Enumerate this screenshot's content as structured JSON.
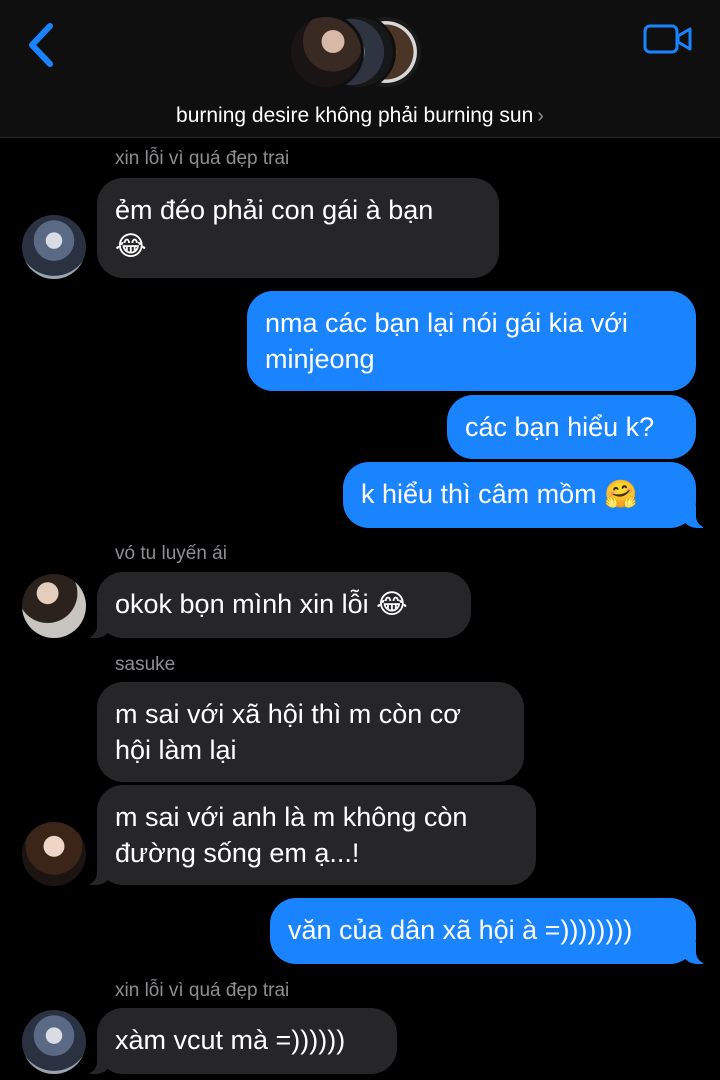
{
  "header": {
    "title": "burning desire không phải burning sun",
    "title_chevron": "›",
    "back_icon": "chevron-left-icon",
    "video_icon": "video-camera-icon",
    "accent_color": "#1a84ff"
  },
  "messages": [
    {
      "sender": "xin lỗi vì quá đẹp trai",
      "text_line1": "ẻm đéo phải con gái à bạn",
      "text_line2": "😂"
    },
    {
      "text_line1": "nma các bạn lại nói gái kia với",
      "text_line2": "minjeong"
    },
    {
      "text": "các bạn hiểu k?"
    },
    {
      "text": "k hiểu thì câm mồm 🤗"
    },
    {
      "sender": "vó tu luyến ái",
      "text": "okok bọn mình xin lỗi 😂"
    },
    {
      "sender": "sasuke",
      "text_line1": "m sai với xã hội thì m còn cơ",
      "text_line2": "hội làm lại"
    },
    {
      "text_line1": "m sai với anh là m không còn",
      "text_line2": "đường sống em ạ...!"
    },
    {
      "text": "văn của dân xã hội à =))))))))"
    },
    {
      "sender": "xin lỗi vì quá đẹp trai",
      "text": "xàm vcut mà =))))))"
    }
  ],
  "colors": {
    "incoming_bubble": "#262628",
    "outgoing_bubble": "#1a84ff",
    "sender_name": "#8e8e93"
  }
}
